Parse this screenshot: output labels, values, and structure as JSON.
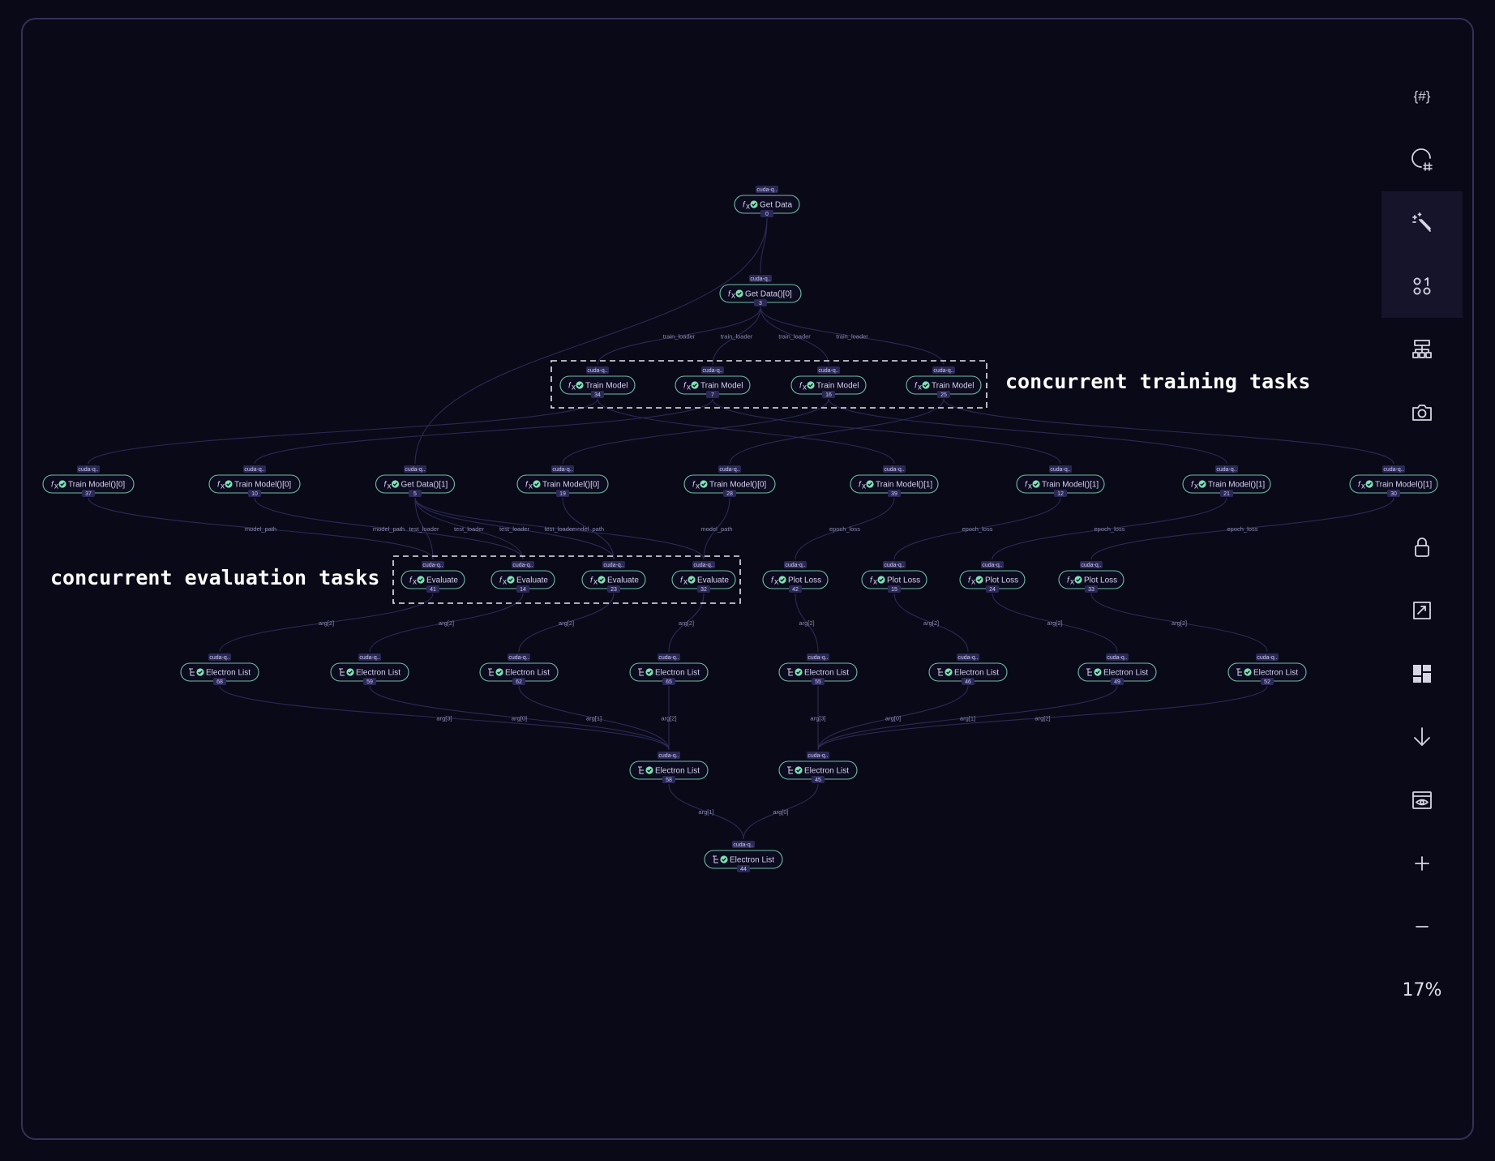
{
  "annotations": {
    "training": "concurrent training tasks",
    "evaluation": "concurrent evaluation tasks"
  },
  "nodes": [
    {
      "id": "n0",
      "label": "Get Data",
      "num": "0",
      "tag": "cuda-q..",
      "icon": "function-icon"
    },
    {
      "id": "n3",
      "label": "Get Data()[0]",
      "num": "3",
      "tag": "cuda-q..",
      "icon": "function-icon"
    },
    {
      "id": "n34",
      "label": "Train Model",
      "num": "34",
      "tag": "cuda-q..",
      "icon": "function-icon"
    },
    {
      "id": "n7",
      "label": "Train Model",
      "num": "7",
      "tag": "cuda-q..",
      "icon": "function-icon"
    },
    {
      "id": "n16",
      "label": "Train Model",
      "num": "16",
      "tag": "cuda-q..",
      "icon": "function-icon"
    },
    {
      "id": "n25",
      "label": "Train Model",
      "num": "25",
      "tag": "cuda-q..",
      "icon": "function-icon"
    },
    {
      "id": "n37",
      "label": "Train Model()[0]",
      "num": "37",
      "tag": "cuda-q..",
      "icon": "function-icon"
    },
    {
      "id": "n10",
      "label": "Train Model()[0]",
      "num": "10",
      "tag": "cuda-q..",
      "icon": "function-icon"
    },
    {
      "id": "n5",
      "label": "Get Data()[1]",
      "num": "5",
      "tag": "cuda-q..",
      "icon": "function-icon"
    },
    {
      "id": "n19",
      "label": "Train Model()[0]",
      "num": "19",
      "tag": "cuda-q..",
      "icon": "function-icon"
    },
    {
      "id": "n28",
      "label": "Train Model()[0]",
      "num": "28",
      "tag": "cuda-q..",
      "icon": "function-icon"
    },
    {
      "id": "n39",
      "label": "Train Model()[1]",
      "num": "39",
      "tag": "cuda-q..",
      "icon": "function-icon"
    },
    {
      "id": "n12",
      "label": "Train Model()[1]",
      "num": "12",
      "tag": "cuda-q..",
      "icon": "function-icon"
    },
    {
      "id": "n21",
      "label": "Train Model()[1]",
      "num": "21",
      "tag": "cuda-q..",
      "icon": "function-icon"
    },
    {
      "id": "n30",
      "label": "Train Model()[1]",
      "num": "30",
      "tag": "cuda-q..",
      "icon": "function-icon"
    },
    {
      "id": "n41",
      "label": "Evaluate",
      "num": "41",
      "tag": "cuda-q..",
      "icon": "function-icon"
    },
    {
      "id": "n14",
      "label": "Evaluate",
      "num": "14",
      "tag": "cuda-q..",
      "icon": "function-icon"
    },
    {
      "id": "n23",
      "label": "Evaluate",
      "num": "23",
      "tag": "cuda-q..",
      "icon": "function-icon"
    },
    {
      "id": "n32",
      "label": "Evaluate",
      "num": "32",
      "tag": "cuda-q..",
      "icon": "function-icon"
    },
    {
      "id": "n42",
      "label": "Plot Loss",
      "num": "42",
      "tag": "cuda-q..",
      "icon": "function-icon"
    },
    {
      "id": "n15",
      "label": "Plot Loss",
      "num": "15",
      "tag": "cuda-q..",
      "icon": "function-icon"
    },
    {
      "id": "n24",
      "label": "Plot Loss",
      "num": "24",
      "tag": "cuda-q..",
      "icon": "function-icon"
    },
    {
      "id": "n33",
      "label": "Plot Loss",
      "num": "33",
      "tag": "cuda-q..",
      "icon": "function-icon"
    },
    {
      "id": "n68",
      "label": "Electron List",
      "num": "68",
      "tag": "cuda-q..",
      "icon": "list-icon"
    },
    {
      "id": "n59",
      "label": "Electron List",
      "num": "59",
      "tag": "cuda-q..",
      "icon": "list-icon"
    },
    {
      "id": "n62",
      "label": "Electron List",
      "num": "62",
      "tag": "cuda-q..",
      "icon": "list-icon"
    },
    {
      "id": "n65",
      "label": "Electron List",
      "num": "65",
      "tag": "cuda-q..",
      "icon": "list-icon"
    },
    {
      "id": "n55",
      "label": "Electron List",
      "num": "55",
      "tag": "cuda-q..",
      "icon": "list-icon"
    },
    {
      "id": "n46",
      "label": "Electron List",
      "num": "46",
      "tag": "cuda-q..",
      "icon": "list-icon"
    },
    {
      "id": "n49",
      "label": "Electron List",
      "num": "49",
      "tag": "cuda-q..",
      "icon": "list-icon"
    },
    {
      "id": "n52",
      "label": "Electron List",
      "num": "52",
      "tag": "cuda-q..",
      "icon": "list-icon"
    },
    {
      "id": "n58",
      "label": "Electron List",
      "num": "58",
      "tag": "cuda-q..",
      "icon": "list-icon"
    },
    {
      "id": "n45",
      "label": "Electron List",
      "num": "45",
      "tag": "cuda-q..",
      "icon": "list-icon"
    },
    {
      "id": "n44",
      "label": "Electron List",
      "num": "44",
      "tag": "cuda-q..",
      "icon": "list-icon"
    }
  ],
  "edges": [
    {
      "from": "n0",
      "to": "n3",
      "label": ""
    },
    {
      "from": "n0",
      "to": "n5",
      "label": ""
    },
    {
      "from": "n3",
      "to": "n34",
      "label": "train_loader"
    },
    {
      "from": "n3",
      "to": "n7",
      "label": "train_loader"
    },
    {
      "from": "n3",
      "to": "n16",
      "label": "train_loader"
    },
    {
      "from": "n3",
      "to": "n25",
      "label": "train_loader"
    },
    {
      "from": "n34",
      "to": "n37",
      "label": ""
    },
    {
      "from": "n34",
      "to": "n39",
      "label": ""
    },
    {
      "from": "n7",
      "to": "n10",
      "label": ""
    },
    {
      "from": "n7",
      "to": "n12",
      "label": ""
    },
    {
      "from": "n16",
      "to": "n19",
      "label": ""
    },
    {
      "from": "n16",
      "to": "n21",
      "label": ""
    },
    {
      "from": "n25",
      "to": "n28",
      "label": ""
    },
    {
      "from": "n25",
      "to": "n30",
      "label": ""
    },
    {
      "from": "n37",
      "to": "n41",
      "label": "model_path"
    },
    {
      "from": "n10",
      "to": "n14",
      "label": "model_path"
    },
    {
      "from": "n19",
      "to": "n23",
      "label": "model_path"
    },
    {
      "from": "n28",
      "to": "n32",
      "label": "model_path"
    },
    {
      "from": "n5",
      "to": "n41",
      "label": "test_loader"
    },
    {
      "from": "n5",
      "to": "n14",
      "label": "test_loader"
    },
    {
      "from": "n5",
      "to": "n23",
      "label": "test_loader"
    },
    {
      "from": "n5",
      "to": "n32",
      "label": "test_loader"
    },
    {
      "from": "n39",
      "to": "n42",
      "label": "epoch_loss"
    },
    {
      "from": "n12",
      "to": "n15",
      "label": "epoch_loss"
    },
    {
      "from": "n21",
      "to": "n24",
      "label": "epoch_loss"
    },
    {
      "from": "n30",
      "to": "n33",
      "label": "epoch_loss"
    },
    {
      "from": "n41",
      "to": "n68",
      "label": "arg[2]"
    },
    {
      "from": "n14",
      "to": "n59",
      "label": "arg[2]"
    },
    {
      "from": "n23",
      "to": "n62",
      "label": "arg[2]"
    },
    {
      "from": "n32",
      "to": "n65",
      "label": "arg[2]"
    },
    {
      "from": "n42",
      "to": "n55",
      "label": "arg[2]"
    },
    {
      "from": "n15",
      "to": "n46",
      "label": "arg[2]"
    },
    {
      "from": "n24",
      "to": "n49",
      "label": "arg[2]"
    },
    {
      "from": "n33",
      "to": "n52",
      "label": "arg[2]"
    },
    {
      "from": "n68",
      "to": "n58",
      "label": "arg[3]"
    },
    {
      "from": "n59",
      "to": "n58",
      "label": "arg[0]"
    },
    {
      "from": "n62",
      "to": "n58",
      "label": "arg[1]"
    },
    {
      "from": "n65",
      "to": "n58",
      "label": "arg[2]"
    },
    {
      "from": "n55",
      "to": "n45",
      "label": "arg[3]"
    },
    {
      "from": "n46",
      "to": "n45",
      "label": "arg[0]"
    },
    {
      "from": "n49",
      "to": "n45",
      "label": "arg[1]"
    },
    {
      "from": "n52",
      "to": "n45",
      "label": "arg[2]"
    },
    {
      "from": "n58",
      "to": "n44",
      "label": "arg[1]"
    },
    {
      "from": "n45",
      "to": "n44",
      "label": "arg[0]"
    }
  ],
  "toolbar": {
    "items": [
      {
        "name": "parameters-button",
        "icon": "braces-hash-icon",
        "text": "{#}"
      },
      {
        "name": "search-hash-button",
        "icon": "search-hash-icon"
      },
      {
        "name": "highlight-button",
        "icon": "magic-wand-icon",
        "active": true
      },
      {
        "name": "labels-button",
        "icon": "zero-one-icon",
        "active": true
      },
      {
        "name": "layout-button",
        "icon": "hierarchy-icon"
      },
      {
        "name": "screenshot-button",
        "icon": "camera-icon"
      },
      {
        "name": "lock-button",
        "icon": "lock-icon"
      },
      {
        "name": "fit-view-button",
        "icon": "fit-view-icon"
      },
      {
        "name": "minimap-button",
        "icon": "dashboard-icon"
      },
      {
        "name": "direction-button",
        "icon": "arrow-down-icon"
      },
      {
        "name": "preview-button",
        "icon": "eye-icon"
      },
      {
        "name": "zoom-in-button",
        "icon": "plus-icon"
      },
      {
        "name": "zoom-out-button",
        "icon": "minus-icon"
      }
    ],
    "zoom": "17%"
  },
  "colors": {
    "background": "#0a0917",
    "node_border": "#6fbfa2",
    "status_ok": "#7ee3b4",
    "edge": "#2b2a57",
    "tag": "#2a2856"
  }
}
